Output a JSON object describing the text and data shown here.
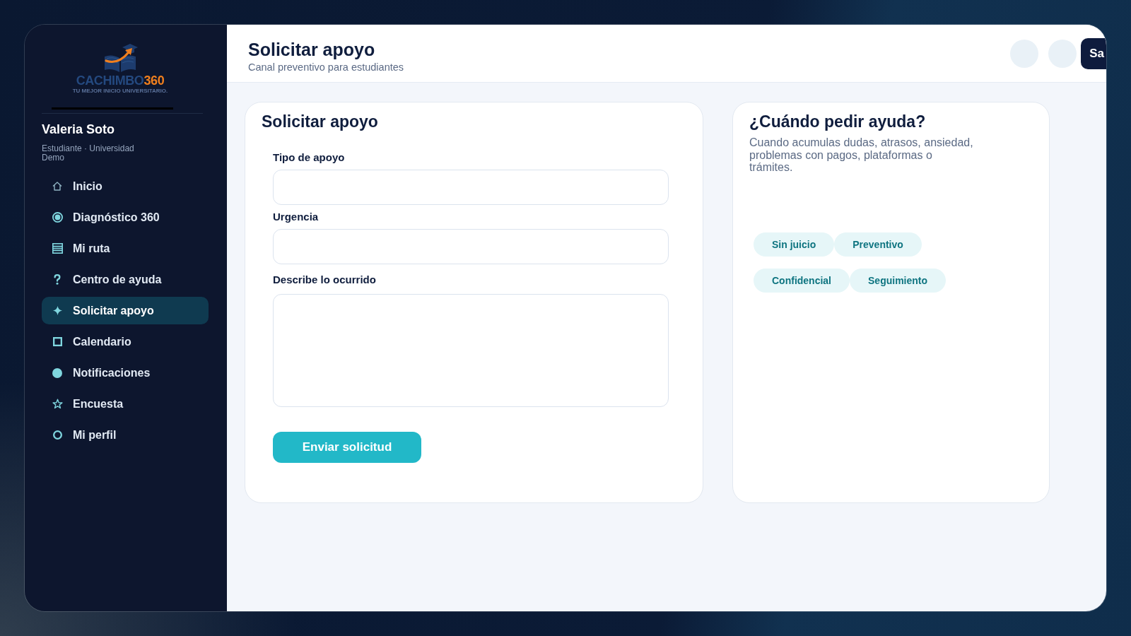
{
  "logo": {
    "name": "CACHIMBO",
    "accent": "360",
    "tagline": "TU MEJOR INICIO UNIVERSITARIO."
  },
  "user": {
    "name": "Valeria Soto",
    "role": "Estudiante · Universidad Demo"
  },
  "sidebar": {
    "items": [
      {
        "label": "Inicio",
        "kind": "home",
        "selected": false
      },
      {
        "label": "Diagnóstico 360",
        "kind": "target",
        "selected": false
      },
      {
        "label": "Mi ruta",
        "kind": "list",
        "selected": false
      },
      {
        "label": "Centro de ayuda",
        "kind": "help",
        "selected": false
      },
      {
        "label": "Solicitar apoyo",
        "kind": "sparkle",
        "selected": true
      },
      {
        "label": "Calendario",
        "kind": "square",
        "selected": false
      },
      {
        "label": "Notificaciones",
        "kind": "dot",
        "selected": false
      },
      {
        "label": "Encuesta",
        "kind": "star",
        "selected": false
      },
      {
        "label": "Mi perfil",
        "kind": "ring",
        "selected": false
      }
    ]
  },
  "header": {
    "title": "Solicitar apoyo",
    "subtitle": "Canal preventivo para estudiantes",
    "button": "Sa"
  },
  "form": {
    "title": "Solicitar apoyo",
    "fields": [
      {
        "label": "Tipo de apoyo",
        "kind": "input"
      },
      {
        "label": "Urgencia",
        "kind": "input"
      },
      {
        "label": "Describe lo ocurrido",
        "kind": "textarea"
      }
    ],
    "submit": "Enviar solicitud"
  },
  "help_card": {
    "title": "¿Cuándo pedir ayuda?",
    "text": "Cuando acumulas dudas, atrasos, ansiedad, problemas con pagos, plataformas o trámites.",
    "tags": [
      "Sin juicio",
      "Preventivo",
      "Confidencial",
      "Seguimiento"
    ]
  }
}
